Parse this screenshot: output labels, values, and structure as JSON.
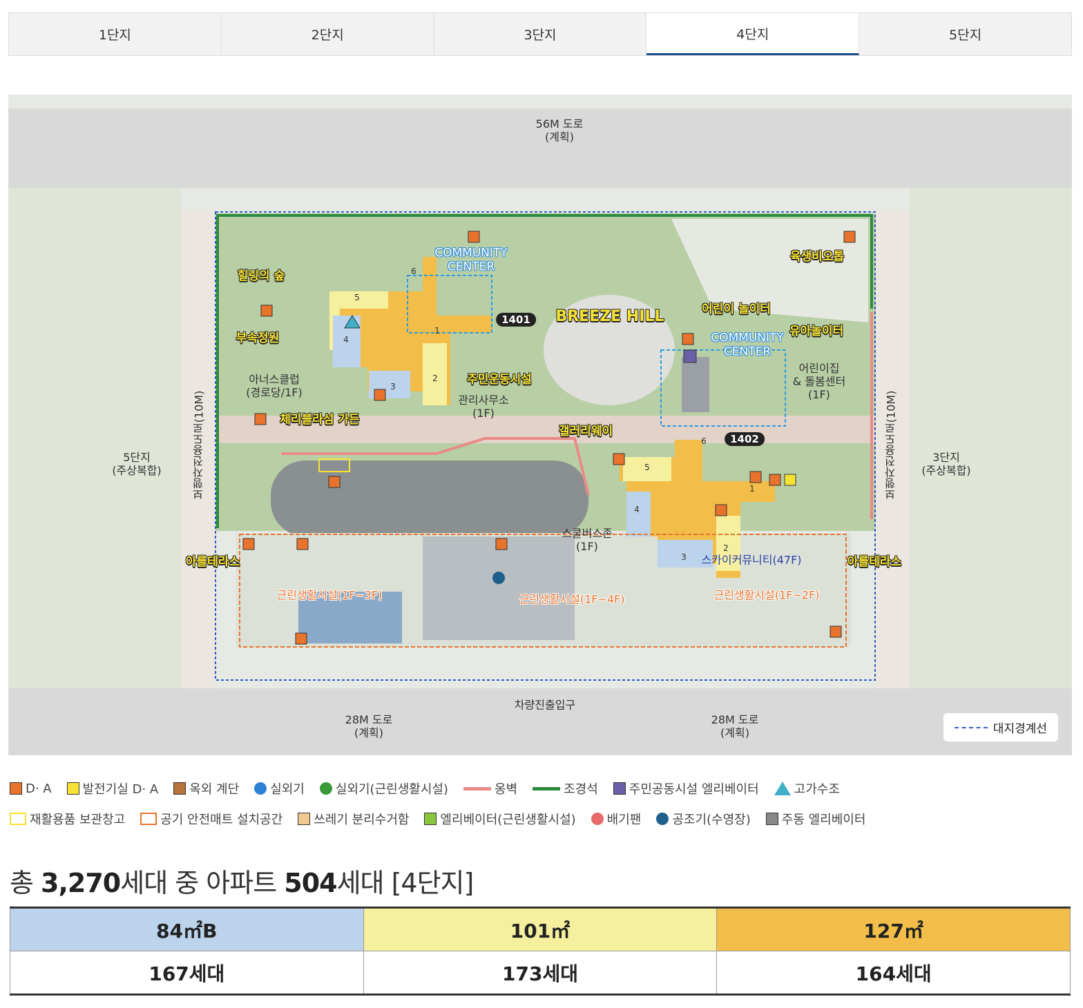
{
  "tabs": [
    {
      "label": "1단지"
    },
    {
      "label": "2단지"
    },
    {
      "label": "3단지"
    },
    {
      "label": "4단지",
      "active": true
    },
    {
      "label": "5단지"
    }
  ],
  "map": {
    "road_top": [
      "56M 도로",
      "(계획)"
    ],
    "healing": "힐링의 숲",
    "garden": "부속정원",
    "honors": [
      "아너스클럽",
      "(경로당/1F)"
    ],
    "cherry": "체리블라섬 가든",
    "community1": [
      "COMMUNITY",
      "CENTER"
    ],
    "b1401": "1401",
    "breeze": "BREEZE HILL",
    "kids": "어린이 놀이터",
    "biotope": "육생비오톱",
    "toddler": "유아놀이터",
    "community2": [
      "COMMUNITY",
      "CENTER"
    ],
    "daycare": [
      "어린이집",
      "& 돌봄센터",
      "(1F)"
    ],
    "fitness": "주민운동시설",
    "office": [
      "관리사무소",
      "(1F)"
    ],
    "gallery": "갤러리웨이",
    "b1402": "1402",
    "complex5": [
      "5단지",
      "(주상복합)"
    ],
    "complex3": [
      "3단지",
      "(주상복합)"
    ],
    "walkway": "보행자전용도로(10M)",
    "schoolbus": [
      "스쿨버스존",
      "(1F)"
    ],
    "sky": "스카이커뮤니티(47F)",
    "terrace": "아를테라스",
    "retail1": "근린생활시설(1F~3F)",
    "retail2": "근린생활시설(1F~4F)",
    "retail3": "근린생활시설(1F~2F)",
    "vehicle": "차량진출입구",
    "road_bottom": [
      "28M 도로",
      "(계획)"
    ],
    "boundary": "대지경계선",
    "bldg_nums": [
      "1",
      "2",
      "3",
      "4",
      "5",
      "6"
    ]
  },
  "legend": [
    [
      {
        "label": "D· A",
        "icon": "orange-square",
        "color": "#e8732c"
      },
      {
        "label": "발전기실 D· A",
        "icon": "yellow-square",
        "color": "#f6e233"
      },
      {
        "label": "옥외 계단",
        "icon": "stairs",
        "color": "#b8733a"
      },
      {
        "label": "실외기",
        "icon": "fan-blue",
        "color": "#2e7fd6"
      },
      {
        "label": "실외기(근린생활시설)",
        "icon": "fan-green",
        "color": "#3a9a3a"
      },
      {
        "label": "옹벽",
        "icon": "line-red",
        "color": "#e98a86"
      },
      {
        "label": "조경석",
        "icon": "line-green",
        "color": "#2e8b3e"
      },
      {
        "label": "주민공동시설 엘리베이터",
        "icon": "elevator-purple",
        "color": "#6b5fa8"
      },
      {
        "label": "고가수조",
        "icon": "triangle",
        "color": "#3fb0c8"
      }
    ],
    [
      {
        "label": "재활용품 보관창고",
        "icon": "yellow-outline",
        "color": "#f6e233"
      },
      {
        "label": "공기 안전매트 설치공간",
        "icon": "mat",
        "color": "#e8732c"
      },
      {
        "label": "쓰레기 분리수거함",
        "icon": "grid",
        "color": "#f0c890"
      },
      {
        "label": "엘리베이터(근린생활시설)",
        "icon": "elevator-green",
        "color": "#8cc63e"
      },
      {
        "label": "배기팬",
        "icon": "fan-red",
        "color": "#e86a6a"
      },
      {
        "label": "공조기(수영장)",
        "icon": "circle",
        "color": "#1f5f8c"
      },
      {
        "label": "주동 엘리베이터",
        "icon": "elevator-gray",
        "color": "#888888"
      }
    ]
  ],
  "summary": {
    "p1": "총 ",
    "total": "3,270",
    "p2": "세대 중 아파트 ",
    "apt": "504",
    "p3": "세대 [4단지]"
  },
  "units": [
    {
      "type": "84㎡B",
      "count": "167세대",
      "color": "#bcd3ec"
    },
    {
      "type": "101㎡",
      "count": "173세대",
      "color": "#f5ef9e"
    },
    {
      "type": "127㎡",
      "count": "164세대",
      "color": "#f2bd48"
    }
  ]
}
